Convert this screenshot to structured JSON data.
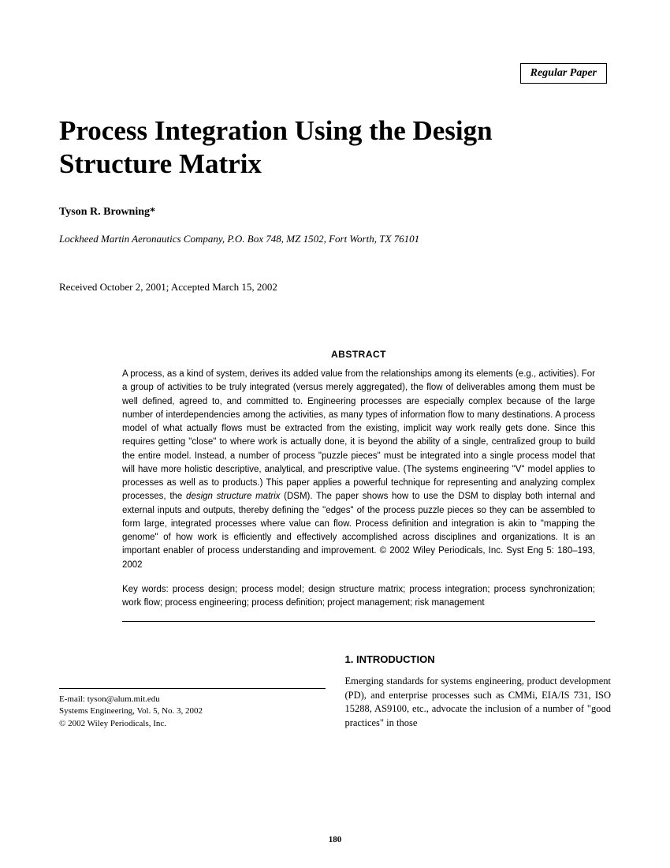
{
  "paperType": "Regular Paper",
  "title": "Process Integration Using the Design Structure Matrix",
  "author": "Tyson R. Browning*",
  "affiliation": "Lockheed Martin Aeronautics Company, P.O. Box 748, MZ 1502, Fort Worth, TX 76101",
  "dates": "Received October 2, 2001; Accepted March 15, 2002",
  "abstractHeading": "ABSTRACT",
  "abstractP1a": "A process, as a kind of system, derives its added value from the relationships among its elements (e.g., activities). For a group of activities to be truly integrated (versus merely aggregated), the flow of deliverables among them must be well defined, agreed to, and committed to. Engineering processes are especially complex because of the large number of interdependencies among the activities, as many types of information flow to many destinations. A process model of what actually flows must be extracted from the existing, implicit way work really gets done. Since this requires getting \"close\" to where work is actually done, it is beyond the ability of a single, centralized group to build the entire model. Instead, a number of process \"puzzle pieces\" must be integrated into a single process model that will have more holistic descriptive, analytical, and prescriptive value. (The systems engineering \"V\" model applies to processes as well as to products.) This paper applies a powerful technique for representing and analyzing complex processes, the ",
  "abstractItalic": "design structure matrix",
  "abstractP1b": " (DSM). The paper shows how to use the DSM to display both internal and external inputs and outputs, thereby defining the \"edges\" of the process puzzle pieces so they can be assembled to form large, integrated processes where value can flow. Process definition and integration is akin to \"mapping the genome\" of how work is efficiently and effectively accomplished across disciplines and organizations. It is an important enabler of process understanding and improvement. © 2002 Wiley Periodicals, Inc. Syst Eng 5: 180–193, 2002",
  "keywords": "Key words: process design; process model; design structure matrix; process integration; process synchronization; work flow; process engineering; process definition; project management; risk management",
  "email": "E-mail: tyson@alum.mit.edu",
  "journal": "Systems Engineering, Vol. 5, No. 3, 2002",
  "copyright": "© 2002 Wiley Periodicals, Inc.",
  "sectionHeading": "1. INTRODUCTION",
  "bodyText": "Emerging standards for systems engineering, product development (PD), and enterprise processes such as CMMi, EIA/IS 731, ISO 15288, AS9100, etc., advocate the inclusion of a number of \"good practices\" in those",
  "pageNumber": "180"
}
